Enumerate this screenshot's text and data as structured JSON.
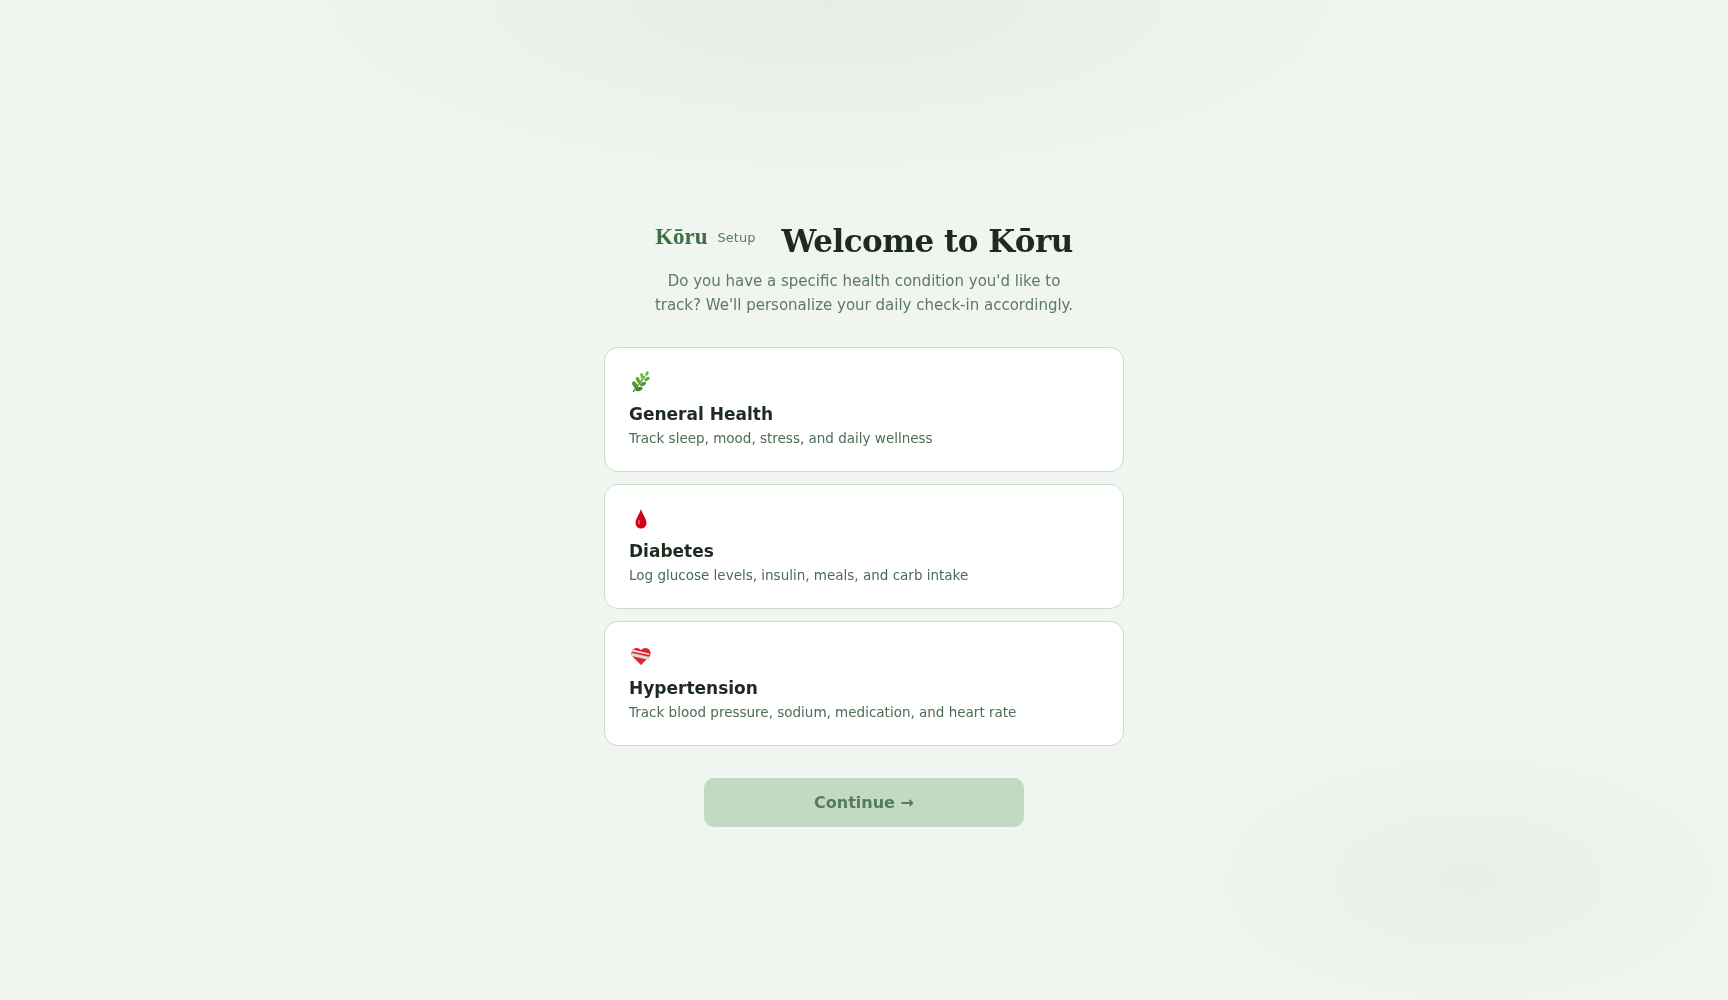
{
  "header": {
    "logo": "Kōru",
    "badge": "Setup",
    "title": "Welcome to Kōru",
    "subtitle": "Do you have a specific health condition you'd like to track? We'll personalize your daily check-in accordingly."
  },
  "options": [
    {
      "kind": "leaf",
      "title": "General Health",
      "description": "Track sleep, mood, stress, and daily wellness",
      "selected": false
    },
    {
      "kind": "drop",
      "title": "Diabetes",
      "description": "Log glucose levels, insulin, meals, and carb intake",
      "selected": false
    },
    {
      "kind": "heart",
      "title": "Hypertension",
      "description": "Track blood pressure, sodium, medication, and heart rate",
      "selected": false
    }
  ],
  "continue_button": {
    "label": "Continue →",
    "disabled": true
  }
}
